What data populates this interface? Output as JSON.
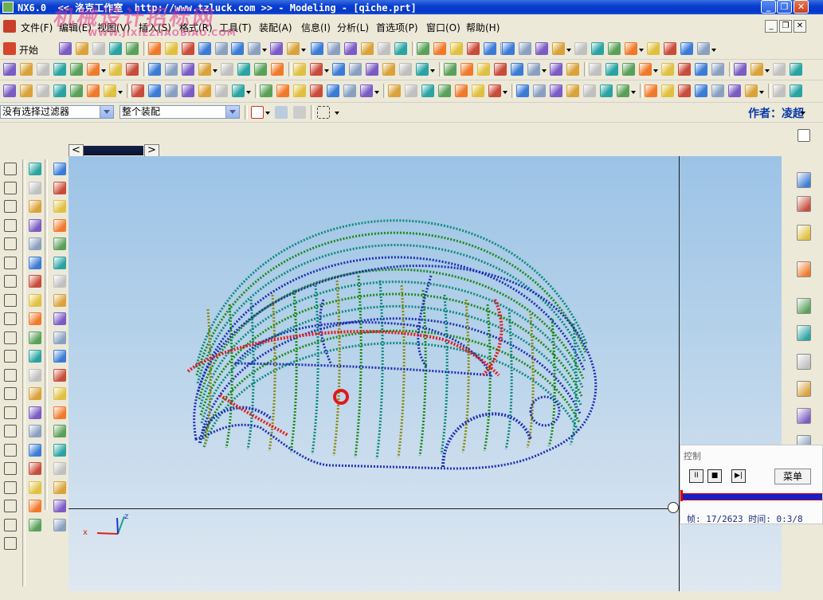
{
  "window": {
    "title": "NX6.0  << 洛克工作室  http://www.tzluck.com >> - Modeling - [qiche.prt]",
    "minimize": "_",
    "restore": "❐",
    "close": "✕"
  },
  "watermark": {
    "main": "机械设计招标网",
    "sub": "WWW.JIXIEZHAOBIAO.COM"
  },
  "menubar": {
    "items": [
      "文件(F)",
      "编辑(E)",
      "视图(V)",
      "插入(S)",
      "格式(R)",
      "工具(T)",
      "装配(A)",
      "信息(I)",
      "分析(L)",
      "首选项(P)",
      "窗口(O)",
      "帮助(H)"
    ],
    "doc_min": "_",
    "doc_restore": "❐",
    "doc_close": "✕"
  },
  "toolbar": {
    "start_label": "开始"
  },
  "selection_bar": {
    "filter_value": "没有选择过滤器",
    "scope_value": "整个装配",
    "author_label": "作者：凌超"
  },
  "navigation": {
    "back": "<",
    "forward": ">"
  },
  "triad": {
    "x_label": "x",
    "z_label": "z"
  },
  "control_panel": {
    "title": "控制",
    "pause": "II",
    "stop": "■",
    "step": "▶|",
    "menu_label": "菜单",
    "frame_text": "帧: 17/2623 时间: 0:3/8"
  },
  "colors": {
    "titlebar": "#0a3ed0",
    "wire_blue": "#1e2fb0",
    "wire_teal": "#0e8a7c",
    "wire_green": "#1b8a1b",
    "wire_olive": "#8c8a10",
    "wire_red": "#e01a1a"
  }
}
